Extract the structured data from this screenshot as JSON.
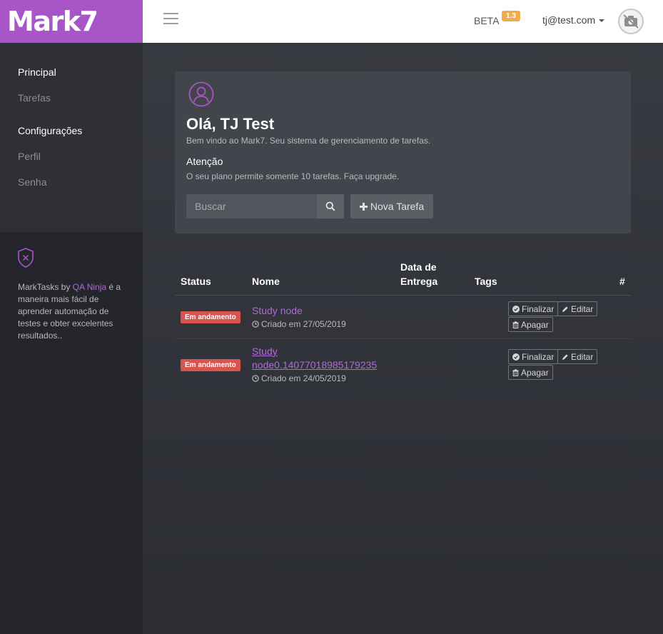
{
  "brand": {
    "logo": "Mark7"
  },
  "header": {
    "beta_label": "BETA",
    "version": "1.3",
    "user_email": "tj@test.com"
  },
  "sidebar": {
    "sections": [
      {
        "title": "Principal",
        "items": [
          "Tarefas"
        ]
      },
      {
        "title": "Configurações",
        "items": [
          "Perfil",
          "Senha"
        ]
      }
    ],
    "info": {
      "prefix": "MarkTasks by ",
      "link": "QA Ninja",
      "suffix": " é a maneira mais fácil de aprender automação de testes e obter excelentes resultados.."
    }
  },
  "panel": {
    "greeting": "Olá, TJ Test",
    "welcome": "Bem vindo ao Mark7. Seu sistema de gerenciamento de tarefas.",
    "attention_title": "Atenção",
    "attention_text": "O seu plano permite somente 10 tarefas. Faça upgrade.",
    "search_placeholder": "Buscar",
    "new_task_label": "Nova Tarefa"
  },
  "table": {
    "columns": {
      "status": "Status",
      "name": "Nome",
      "due_line1": "Data de",
      "due_line2": "Entrega",
      "tags": "Tags",
      "actions": "#"
    },
    "rows": [
      {
        "status": "Em andamento",
        "name_line1": "Study node",
        "name_line2": "",
        "created": "Criado em 27/05/2019",
        "actions": {
          "finish": "Finalizar",
          "edit": "Editar",
          "delete": "Apagar"
        }
      },
      {
        "status": "Em andamento",
        "name_line1": "Study",
        "name_line2": "node0.14077018985179235",
        "created": "Criado em 24/05/2019",
        "actions": {
          "finish": "Finalizar",
          "edit": "Editar",
          "delete": "Apagar"
        }
      }
    ]
  },
  "colors": {
    "brand": "#a855c8",
    "link": "#b06ad8",
    "status_danger": "#d9534f",
    "beta_badge": "#f0ad4e"
  }
}
